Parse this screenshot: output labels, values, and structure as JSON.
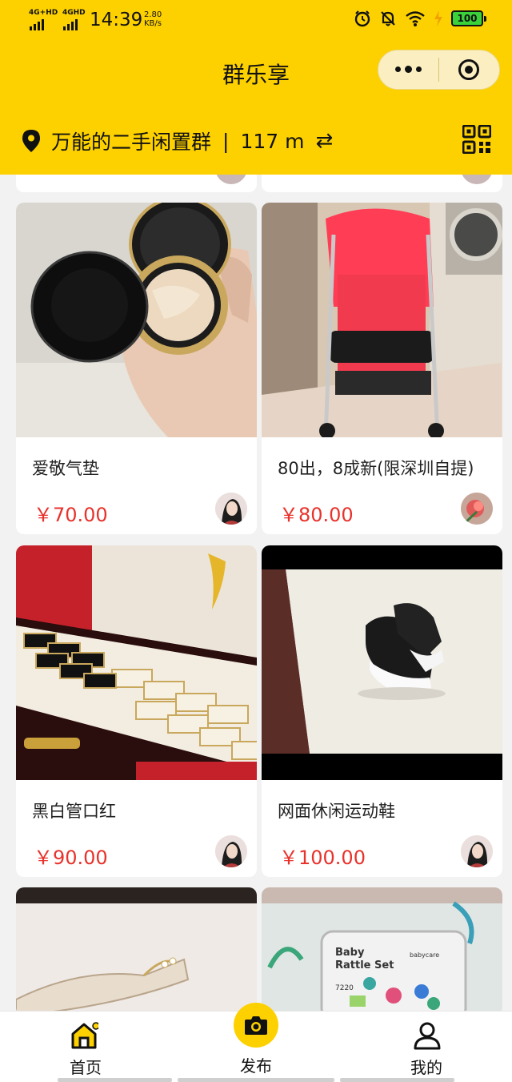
{
  "status_bar": {
    "network_1": "4G+HD",
    "network_2": "4GHD",
    "time": "14:39",
    "speed_value": "2.80",
    "speed_unit": "KB/s",
    "battery": "100"
  },
  "header": {
    "title": "群乐享",
    "group_name": "万能的二手闲置群",
    "separator": "|",
    "distance": "117 m",
    "swap_symbol": "⇄"
  },
  "products": [
    {
      "name": "爱敬气垫",
      "price": "￥70.00"
    },
    {
      "name": "80出，8成新(限深圳自提)",
      "price": "￥80.00"
    },
    {
      "name": "黑白管口红",
      "price": "￥90.00"
    },
    {
      "name": "网面休闲运动鞋",
      "price": "￥100.00"
    }
  ],
  "partial_products": [
    {
      "box_text_1": "Baby",
      "box_text_2": "Rattle Set",
      "box_brand": "babycare",
      "box_code": "7220"
    }
  ],
  "tabbar": {
    "home": "首页",
    "publish": "发布",
    "me": "我的"
  },
  "colors": {
    "brand_yellow": "#fdd100",
    "price_red": "#e8322c",
    "background": "#f2f2f2"
  }
}
